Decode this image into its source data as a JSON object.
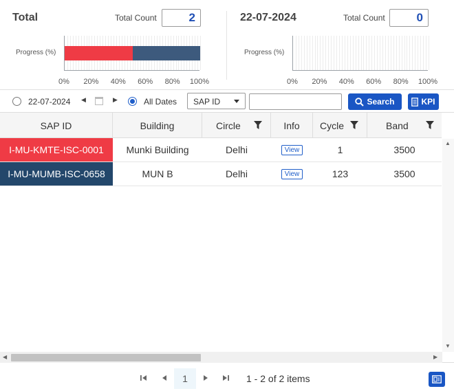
{
  "summary": {
    "total": {
      "title": "Total",
      "count_label": "Total Count",
      "count": "2",
      "progress_label": "Progress (%)",
      "progress_segments": [
        {
          "name": "red",
          "percent": 50,
          "color": "#ef3b45"
        },
        {
          "name": "navy",
          "percent": 50,
          "color": "#3d5a7d"
        }
      ],
      "ticks": [
        "0%",
        "20%",
        "40%",
        "60%",
        "80%",
        "100%"
      ]
    },
    "date": {
      "title": "22-07-2024",
      "count_label": "Total Count",
      "count": "0",
      "progress_label": "Progress (%)",
      "ticks": [
        "0%",
        "20%",
        "40%",
        "60%",
        "80%",
        "100%"
      ]
    }
  },
  "toolbar": {
    "date_option": "22-07-2024",
    "all_dates_label": "All Dates",
    "all_dates_selected": true,
    "select_value": "SAP ID",
    "search_value": "",
    "search_label": "Search",
    "kpi_label": "KPI"
  },
  "grid": {
    "columns": [
      "SAP ID",
      "Building",
      "Circle",
      "Info",
      "Cycle",
      "Band"
    ],
    "rows": [
      {
        "sap_id": "I-MU-KMTE-ISC-0001",
        "building": "Munki Building",
        "circle": "Delhi",
        "info": "View",
        "cycle": "1",
        "band": "3500",
        "color": "#ef3b45"
      },
      {
        "sap_id": "I-MU-MUMB-ISC-0658",
        "building": "MUN B",
        "circle": "Delhi",
        "info": "View",
        "cycle": "123",
        "band": "3500",
        "color": "#23476b"
      }
    ]
  },
  "pager": {
    "current_page": "1",
    "info": "1 - 2 of 2 items"
  },
  "colors": {
    "accent": "#1a56c4",
    "header_bg": "#f5f5f5"
  }
}
